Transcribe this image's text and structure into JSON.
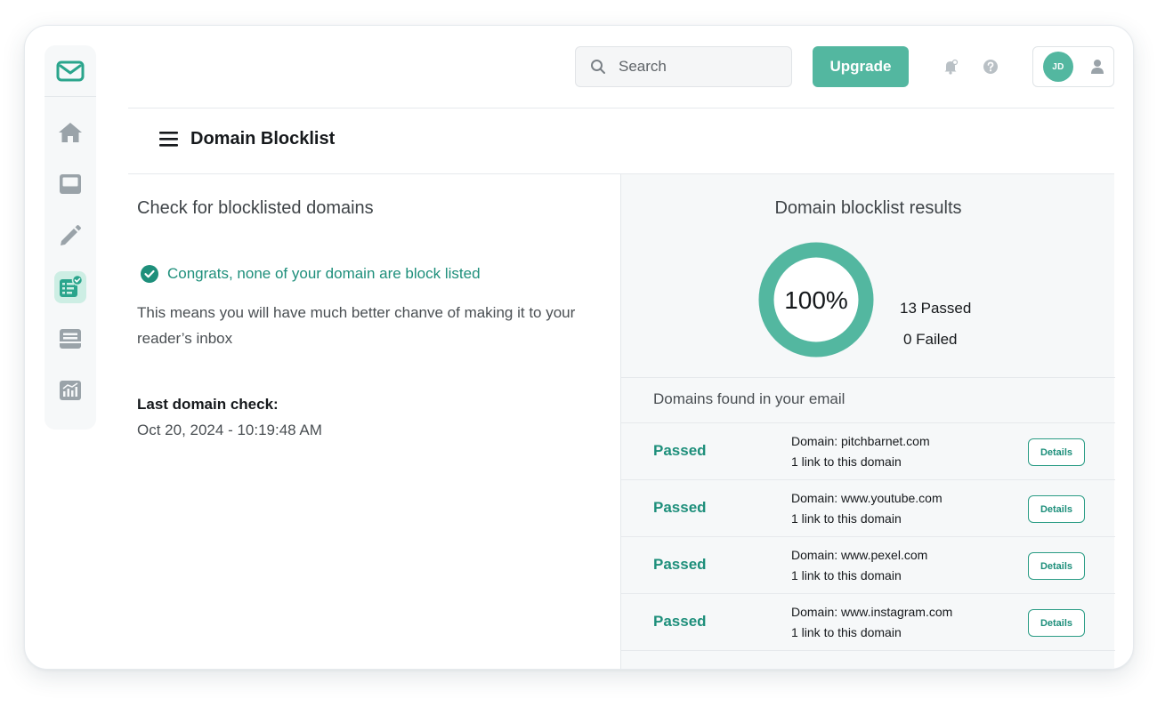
{
  "colors": {
    "accent": "#53b7a0",
    "accent_dark": "#1e8f7b",
    "panel_bg": "#f6f8f9",
    "sidebar_active_bg": "#cdeee4"
  },
  "sidebar": {
    "logo_icon": "mail-check-icon",
    "items": [
      {
        "icon": "home-icon",
        "active": false
      },
      {
        "icon": "inbox-icon",
        "active": false
      },
      {
        "icon": "pencil-icon",
        "active": false
      },
      {
        "icon": "checklist-icon",
        "active": true
      },
      {
        "icon": "archive-tray-icon",
        "active": false
      },
      {
        "icon": "analytics-chart-icon",
        "active": false
      }
    ]
  },
  "topbar": {
    "search_placeholder": "Search",
    "upgrade_label": "Upgrade",
    "notification_icon": "bell-icon",
    "help_icon": "help-icon",
    "avatar_initials": "JD",
    "profile_icon": "person-icon"
  },
  "page": {
    "menu_icon": "hamburger-menu-icon",
    "title": "Domain Blocklist"
  },
  "left": {
    "heading": "Check for blocklisted domains",
    "congrats": "Congrats, none of your domain are block listed",
    "description": "This means you will have much better chanve of making it to your reader’s inbox",
    "last_check_label": "Last domain check:",
    "last_check_value": "Oct 20, 2024 - 10:19:48 AM"
  },
  "results": {
    "title": "Domain blocklist results",
    "percent": 100,
    "percent_label": "100%",
    "passed_label": "13 Passed",
    "failed_label": "0 Failed",
    "found_title": "Domains found in your email",
    "rows": [
      {
        "status": "Passed",
        "domain": "Domain: pitchbarnet.com",
        "links": "1 link to this domain",
        "button": "Details"
      },
      {
        "status": "Passed",
        "domain": "Domain: www.youtube.com",
        "links": "1 link to this domain",
        "button": "Details"
      },
      {
        "status": "Passed",
        "domain": "Domain: www.pexel.com",
        "links": "1 link to this domain",
        "button": "Details"
      },
      {
        "status": "Passed",
        "domain": "Domain: www.instagram.com",
        "links": "1 link to this domain",
        "button": "Details"
      }
    ]
  }
}
